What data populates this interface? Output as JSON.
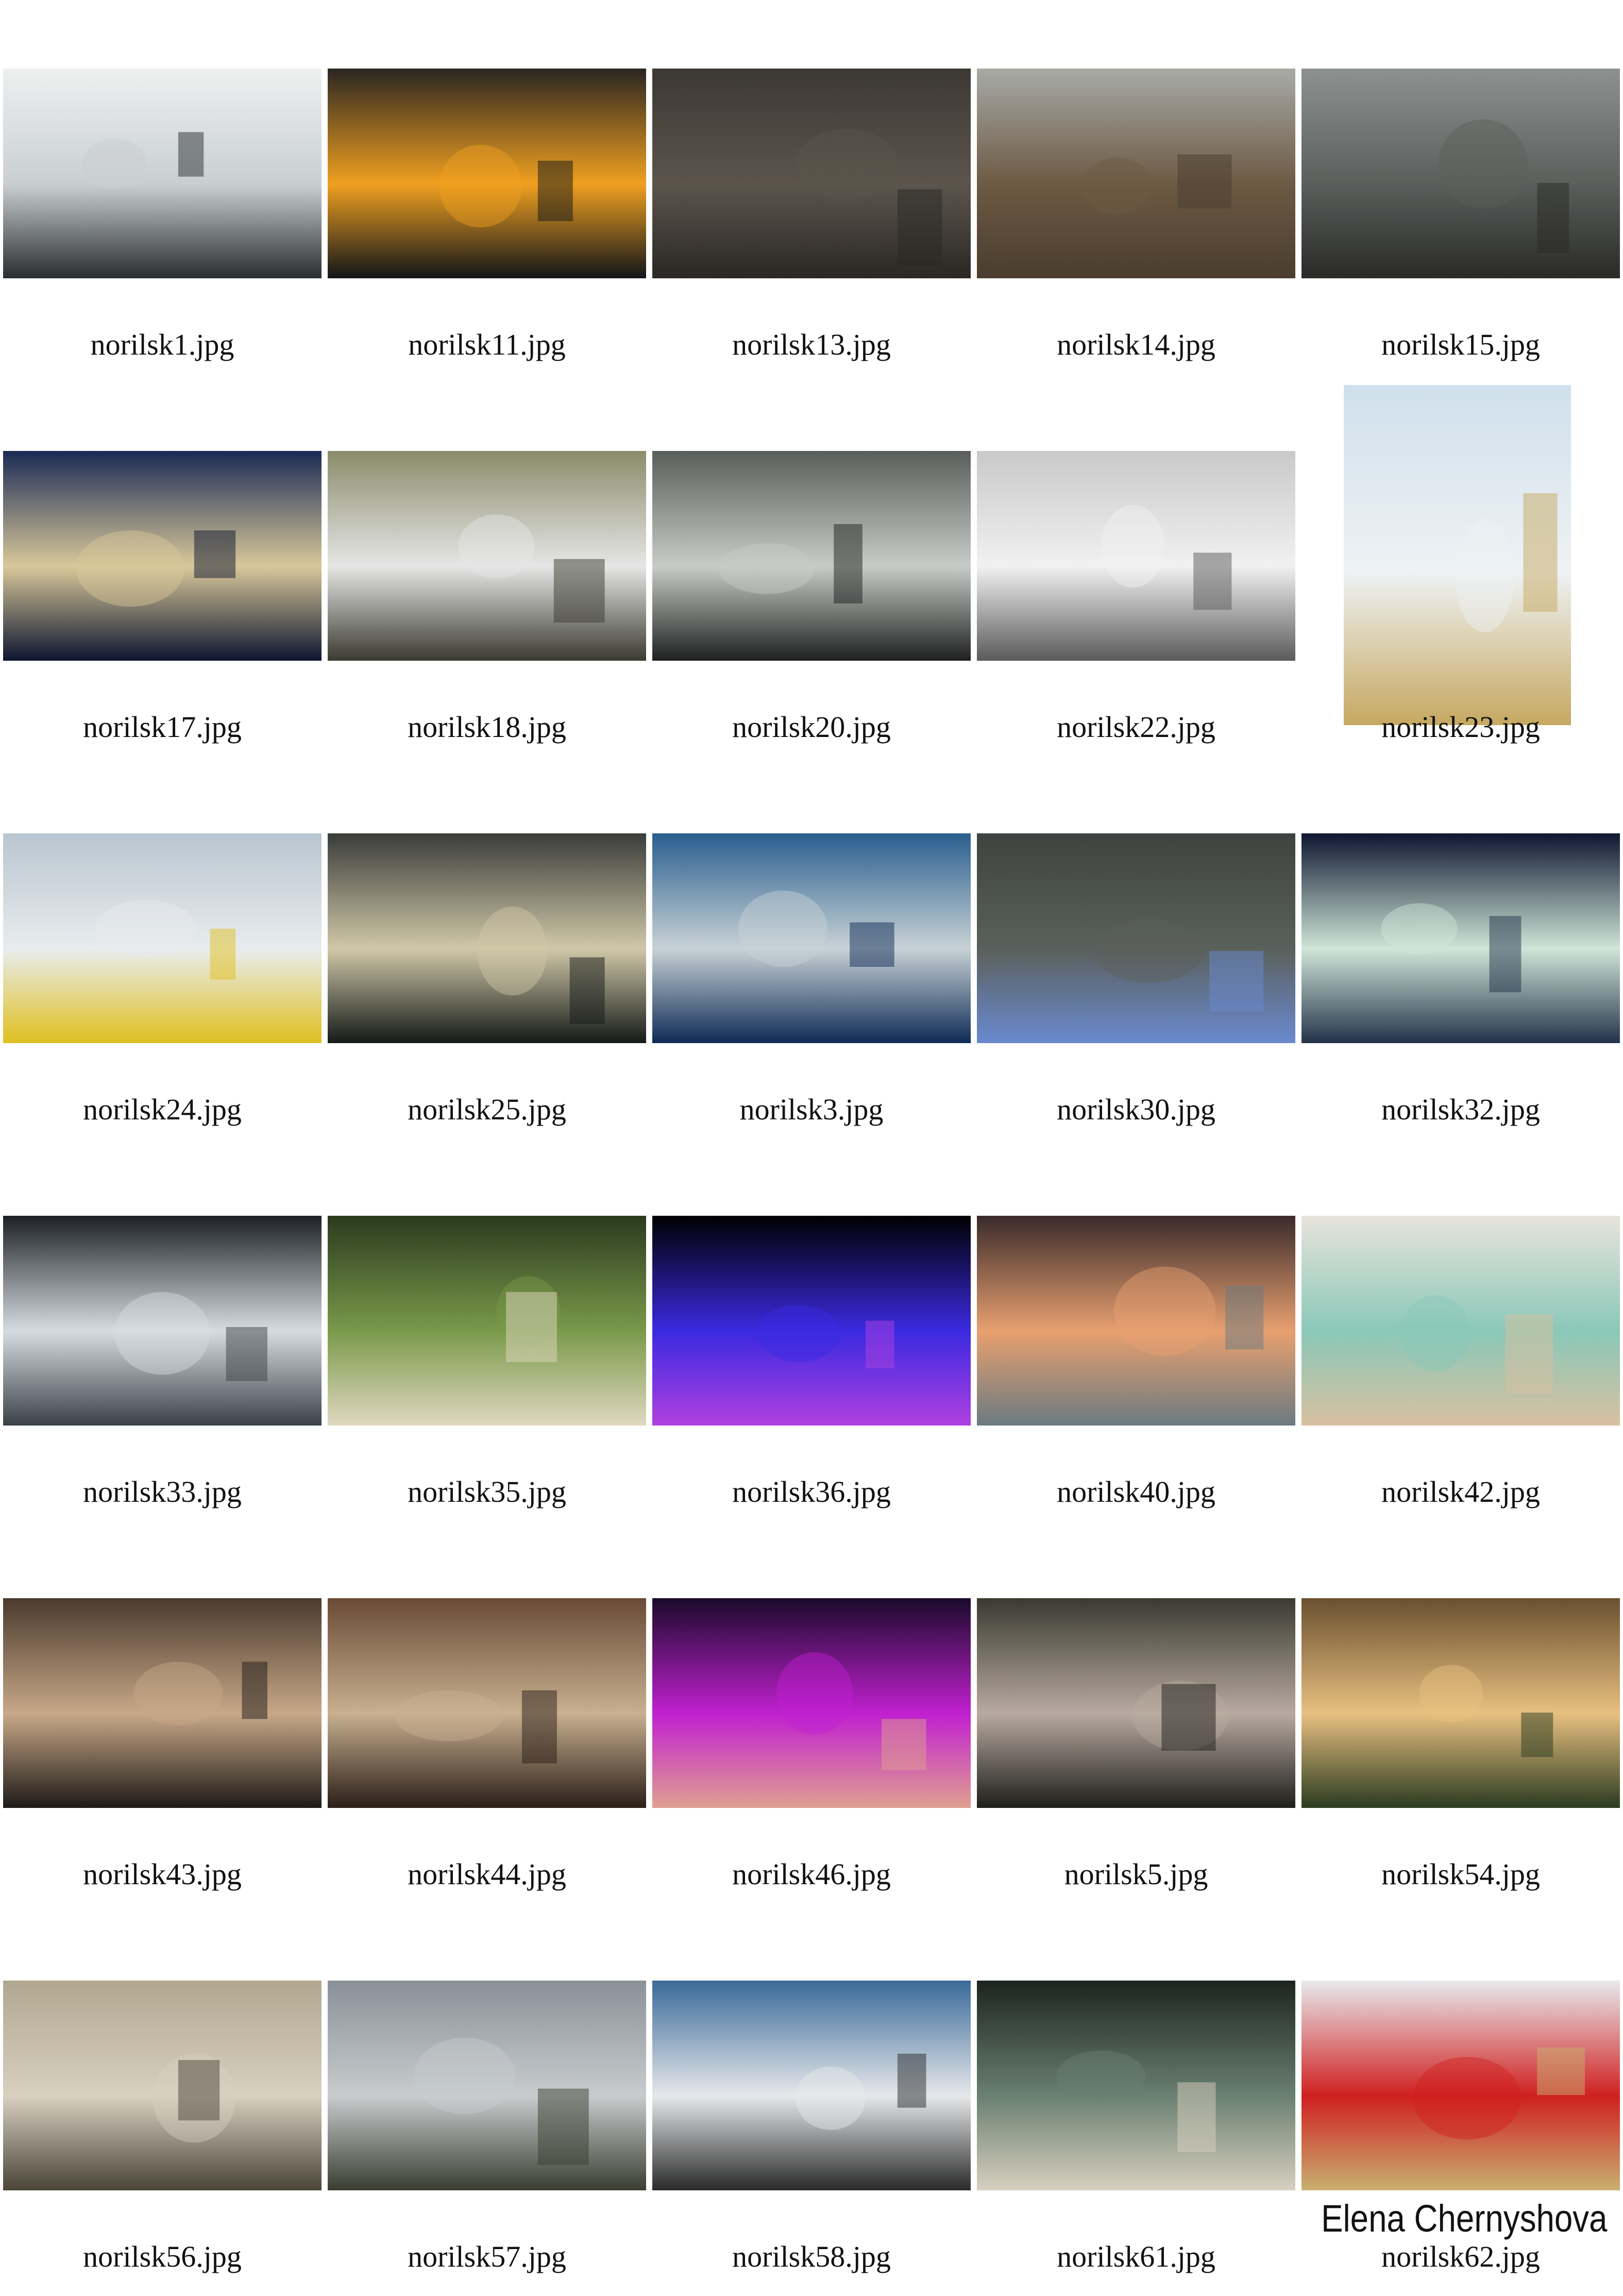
{
  "credit": "Elena Chernyshova",
  "photos": [
    {
      "file": "norilsk1.jpg",
      "scene": "aerial frozen river, snow and dark meanders",
      "colors": [
        "#eef0f0",
        "#c9cfd1",
        "#2a2d30"
      ]
    },
    {
      "file": "norilsk11.jpg",
      "scene": "smelter worker by molten metal fire",
      "colors": [
        "#2a2622",
        "#f0a020",
        "#11151a"
      ]
    },
    {
      "file": "norilsk13.jpg",
      "scene": "dead tree in barren valley",
      "colors": [
        "#3c3833",
        "#5c554c",
        "#2a2724"
      ]
    },
    {
      "file": "norilsk14.jpg",
      "scene": "barren tundra under haze",
      "colors": [
        "#a8aaa6",
        "#6d5a44",
        "#4a3c2e"
      ]
    },
    {
      "file": "norilsk15.jpg",
      "scene": "woman in face mask, smoking chimneys",
      "colors": [
        "#8d9290",
        "#5a5f5c",
        "#2a2a28"
      ]
    },
    {
      "file": "norilsk17.jpg",
      "scene": "city at night, snowy boulevard",
      "colors": [
        "#1a2a55",
        "#d9c89a",
        "#0d1530"
      ]
    },
    {
      "file": "norilsk18.jpg",
      "scene": "soviet apartment blocks in snow",
      "colors": [
        "#8a8c6a",
        "#e6e6e6",
        "#3a3a30"
      ]
    },
    {
      "file": "norilsk20.jpg",
      "scene": "abandoned snowy interior stairwell",
      "colors": [
        "#5a5e5a",
        "#c8ccc8",
        "#1d201e"
      ]
    },
    {
      "file": "norilsk22.jpg",
      "scene": "abandoned block, figure in snow",
      "colors": [
        "#c9c9c9",
        "#f1f1f1",
        "#5a5a5a"
      ]
    },
    {
      "file": "norilsk23.jpg",
      "scene": "building top behind snow drift",
      "colors": [
        "#cfe0ec",
        "#eef2f4",
        "#c6a860"
      ]
    },
    {
      "file": "norilsk24.jpg",
      "scene": "yellow bus on snowy road",
      "colors": [
        "#b9c6d0",
        "#e8ecee",
        "#e0c020"
      ]
    },
    {
      "file": "norilsk25.jpg",
      "scene": "street lights in foggy night",
      "colors": [
        "#3a3c3a",
        "#d0c8a8",
        "#151a18"
      ]
    },
    {
      "file": "norilsk3.jpg",
      "scene": "steam cloud over frozen bay",
      "colors": [
        "#2a5e8e",
        "#c8d2d6",
        "#0e2a55"
      ]
    },
    {
      "file": "norilsk30.jpg",
      "scene": "apartment facade, lit window",
      "colors": [
        "#3e4340",
        "#5a605c",
        "#6a8ad0"
      ]
    },
    {
      "file": "norilsk32.jpg",
      "scene": "lit window with plants at night",
      "colors": [
        "#0e1630",
        "#cfe6d8",
        "#24324a"
      ]
    },
    {
      "file": "norilsk33.jpg",
      "scene": "two figures at frosted window",
      "colors": [
        "#1c2024",
        "#d6dde2",
        "#3a4148"
      ]
    },
    {
      "file": "norilsk35.jpg",
      "scene": "woman tending indoor garden",
      "colors": [
        "#2a3a1e",
        "#7a9a4a",
        "#e0d8c0"
      ]
    },
    {
      "file": "norilsk36.jpg",
      "scene": "blue and purple lights in darkness",
      "colors": [
        "#000000",
        "#3a2ae0",
        "#b040e0"
      ]
    },
    {
      "file": "norilsk40.jpg",
      "scene": "kids running in glowing mist",
      "colors": [
        "#3a2a2a",
        "#e8a070",
        "#6a7a80"
      ]
    },
    {
      "file": "norilsk42.jpg",
      "scene": "children playing in pool hall",
      "colors": [
        "#e8e4dc",
        "#8ac8b8",
        "#d8c0a0"
      ]
    },
    {
      "file": "norilsk43.jpg",
      "scene": "family in living room with lights",
      "colors": [
        "#4a3a2e",
        "#c8a888",
        "#1e1a18"
      ]
    },
    {
      "file": "norilsk44.jpg",
      "scene": "girls playing violin in room",
      "colors": [
        "#6a4a36",
        "#c8b090",
        "#2a1e18"
      ]
    },
    {
      "file": "norilsk46.jpg",
      "scene": "dancers under purple club light",
      "colors": [
        "#1a0a2a",
        "#c020d0",
        "#e0a090"
      ]
    },
    {
      "file": "norilsk5.jpg",
      "scene": "elderly woman holding photograph",
      "colors": [
        "#3a3a30",
        "#b8aaa0",
        "#1e1e1a"
      ]
    },
    {
      "file": "norilsk54.jpg",
      "scene": "sunlit wall and green bag",
      "colors": [
        "#6a5030",
        "#e8c080",
        "#2a3a20"
      ]
    },
    {
      "file": "norilsk56.jpg",
      "scene": "courtyard puddle reflecting blocks",
      "colors": [
        "#b0a890",
        "#d8d0c0",
        "#4a4438"
      ]
    },
    {
      "file": "norilsk57.jpg",
      "scene": "industrial smoke over river",
      "colors": [
        "#8a9098",
        "#c8ccce",
        "#3a3e30"
      ]
    },
    {
      "file": "norilsk58.jpg",
      "scene": "sunbathers on car by water",
      "colors": [
        "#3a6a9a",
        "#e6e8ea",
        "#2a2a2a"
      ]
    },
    {
      "file": "norilsk61.jpg",
      "scene": "woman behind cracked windshield",
      "colors": [
        "#1c2420",
        "#6a8070",
        "#d8d0c0"
      ]
    },
    {
      "file": "norilsk62.jpg",
      "scene": "men in red caps at picnic table",
      "colors": [
        "#e8eaee",
        "#d02020",
        "#c8b070"
      ]
    }
  ]
}
